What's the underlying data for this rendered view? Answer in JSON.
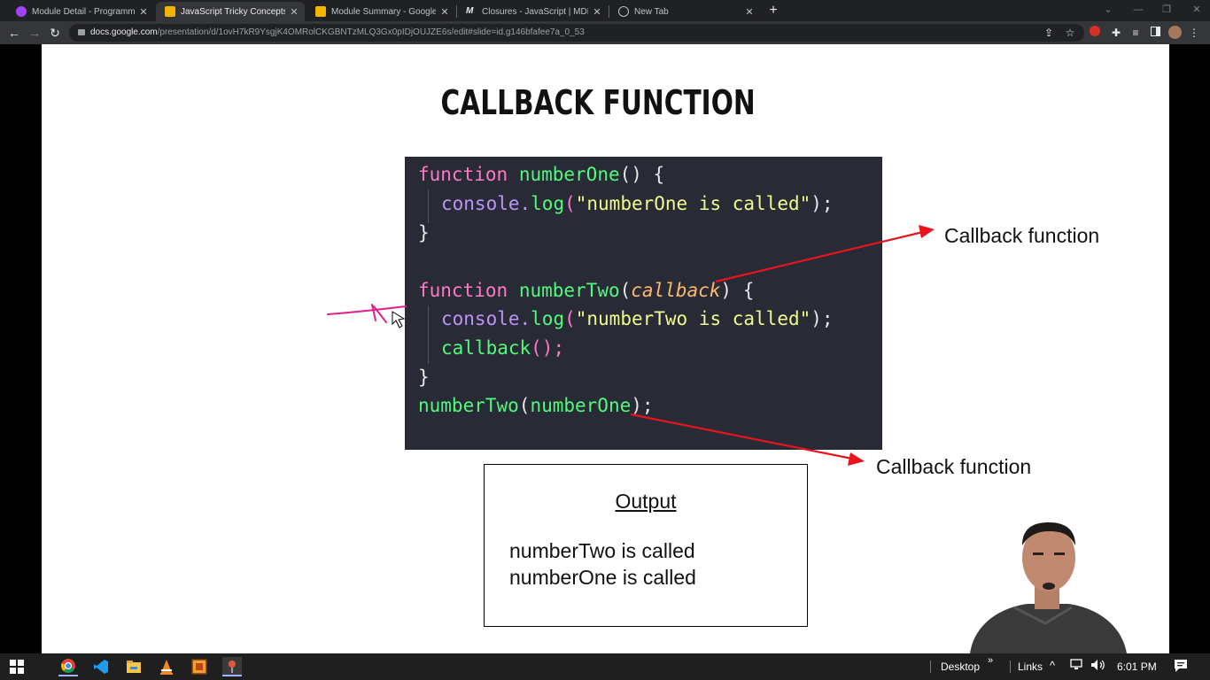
{
  "tabs": [
    {
      "title": "Module Detail - Programming H",
      "color": "#a142f4"
    },
    {
      "title": "JavaScript Tricky Concepts - Goo",
      "color": "#f4b400"
    },
    {
      "title": "Module Summary - Google Slide",
      "color": "#f4b400"
    },
    {
      "title": "Closures - JavaScript | MDN",
      "color": "#9aa0a6"
    },
    {
      "title": "New Tab",
      "color": "#9aa0a6"
    }
  ],
  "tab_close_glyph": "✕",
  "address": {
    "host": "docs.google.com",
    "path": "/presentation/d/1ovH7kR9YsgjK4OMRolCKGBNTzMLQ3Gx0pIDjOUJZE6s/edit#slide=id.g146bfafee7a_0_53"
  },
  "slide": {
    "title": "CALLBACK FUNCTION",
    "code": {
      "l1": {
        "kw": "function",
        "name": "numberOne",
        "rest": "() {"
      },
      "l2": {
        "obj": "console.",
        "method": "log",
        "p1": "(",
        "str": "\"numberOne is called\"",
        "p2": ");"
      },
      "l3": "}",
      "l5": {
        "kw": "function",
        "name": "numberTwo",
        "p1": "(",
        "param": "callback",
        "p2": ") {"
      },
      "l6": {
        "obj": "console.",
        "method": "log",
        "p1": "(",
        "str": "\"numberTwo is called\"",
        "p2": ");"
      },
      "l7": {
        "name": "callback",
        "rest": "();"
      },
      "l8": "}",
      "l9": {
        "name": "numberTwo",
        "p1": "(",
        "arg": "numberOne",
        "p2": ");"
      }
    },
    "callout_top": "Callback function",
    "callout_bottom": "Callback function",
    "output": {
      "title": "Output",
      "lines": [
        "numberTwo is called",
        "numberOne is called"
      ]
    }
  },
  "taskbar": {
    "desktop_label": "Desktop",
    "links_label": "Links",
    "time": "6:01 PM"
  },
  "colors": {
    "annotation_red": "#e8141c",
    "pen_magenta": "#e0208a",
    "code_bg": "#282a36"
  }
}
